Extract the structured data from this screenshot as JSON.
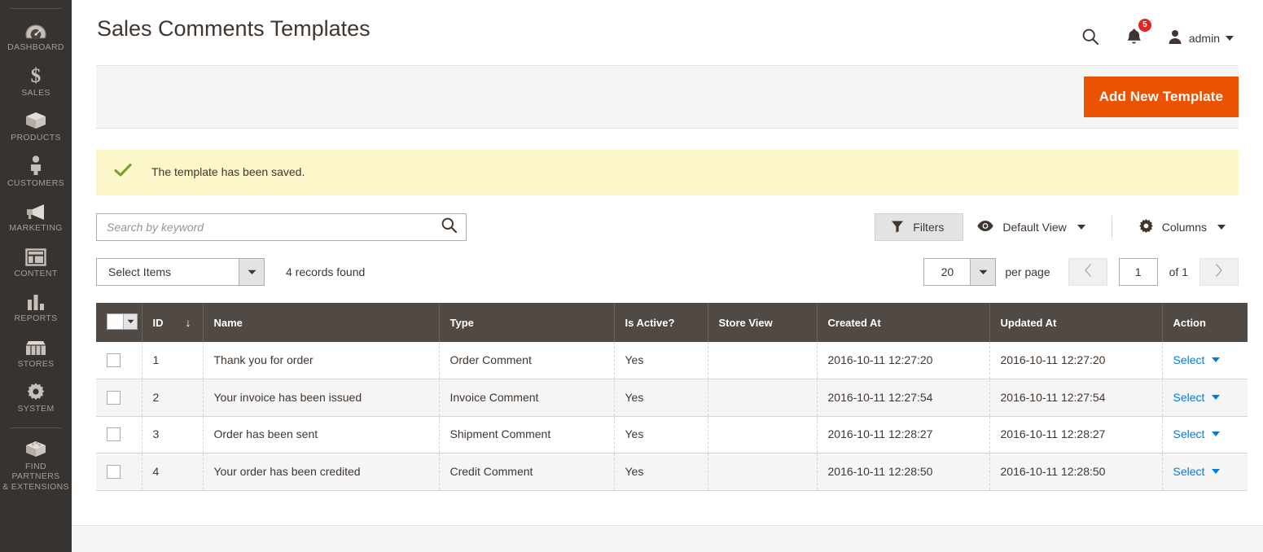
{
  "sidebar": {
    "items": [
      {
        "label": "DASHBOARD",
        "icon": "dashboard-icon"
      },
      {
        "label": "SALES",
        "icon": "dollar-icon"
      },
      {
        "label": "PRODUCTS",
        "icon": "box-icon"
      },
      {
        "label": "CUSTOMERS",
        "icon": "person-icon"
      },
      {
        "label": "MARKETING",
        "icon": "megaphone-icon"
      },
      {
        "label": "CONTENT",
        "icon": "layout-icon"
      },
      {
        "label": "REPORTS",
        "icon": "bar-chart-icon"
      },
      {
        "label": "STORES",
        "icon": "storefront-icon"
      },
      {
        "label": "SYSTEM",
        "icon": "gear-icon"
      }
    ],
    "footer_item": {
      "label": "FIND PARTNERS\n& EXTENSIONS",
      "label_line1": "FIND PARTNERS",
      "label_line2": "& EXTENSIONS",
      "icon": "extension-block-icon"
    }
  },
  "header": {
    "title": "Sales Comments Templates",
    "search_icon": "search-icon",
    "notifications": {
      "icon": "bell-icon",
      "count": "5"
    },
    "user": {
      "icon": "user-avatar-icon",
      "name": "admin"
    }
  },
  "page_actions": {
    "add_button_label": "Add New Template"
  },
  "message": {
    "icon": "check-icon",
    "text": "The template has been saved."
  },
  "toolbar": {
    "search_placeholder": "Search by keyword",
    "search_value": "",
    "search_icon": "search-icon",
    "filters_label": "Filters",
    "filters_icon": "funnel-icon",
    "view_label": "Default View",
    "view_icon": "eye-icon",
    "columns_label": "Columns",
    "columns_icon": "gear-icon"
  },
  "grid_actions": {
    "select_items_label": "Select Items",
    "records_found": "4 records found",
    "per_page_value": "20",
    "per_page_label": "per page",
    "prev_icon": "chevron-left-icon",
    "next_icon": "chevron-right-icon",
    "page_value": "1",
    "page_total": "of 1"
  },
  "grid": {
    "columns": [
      {
        "key": "checkbox",
        "label": ""
      },
      {
        "key": "id",
        "label": "ID",
        "sorted": "desc",
        "sort_icon": "arrow-down-icon"
      },
      {
        "key": "name",
        "label": "Name"
      },
      {
        "key": "type",
        "label": "Type"
      },
      {
        "key": "is_active",
        "label": "Is Active?"
      },
      {
        "key": "store_view",
        "label": "Store View"
      },
      {
        "key": "created_at",
        "label": "Created At"
      },
      {
        "key": "updated_at",
        "label": "Updated At"
      },
      {
        "key": "action",
        "label": "Action"
      }
    ],
    "rows": [
      {
        "id": "1",
        "name": "Thank you for order",
        "type": "Order Comment",
        "is_active": "Yes",
        "store_view": "",
        "created_at": "2016-10-11 12:27:20",
        "updated_at": "2016-10-11 12:27:20",
        "action": "Select"
      },
      {
        "id": "2",
        "name": "Your invoice has been issued",
        "type": "Invoice Comment",
        "is_active": "Yes",
        "store_view": "",
        "created_at": "2016-10-11 12:27:54",
        "updated_at": "2016-10-11 12:27:54",
        "action": "Select"
      },
      {
        "id": "3",
        "name": "Order has been sent",
        "type": "Shipment Comment",
        "is_active": "Yes",
        "store_view": "",
        "created_at": "2016-10-11 12:28:27",
        "updated_at": "2016-10-11 12:28:27",
        "action": "Select"
      },
      {
        "id": "4",
        "name": "Your order has been credited",
        "type": "Credit Comment",
        "is_active": "Yes",
        "store_view": "",
        "created_at": "2016-10-11 12:28:50",
        "updated_at": "2016-10-11 12:28:50",
        "action": "Select"
      }
    ]
  },
  "colors": {
    "sidebar_bg": "#373330",
    "accent_orange": "#eb5202",
    "table_header_bg": "#514943",
    "link_blue": "#007bdb",
    "message_bg": "#fbf7cb",
    "check_green": "#79a22e",
    "badge_red": "#e22626"
  }
}
